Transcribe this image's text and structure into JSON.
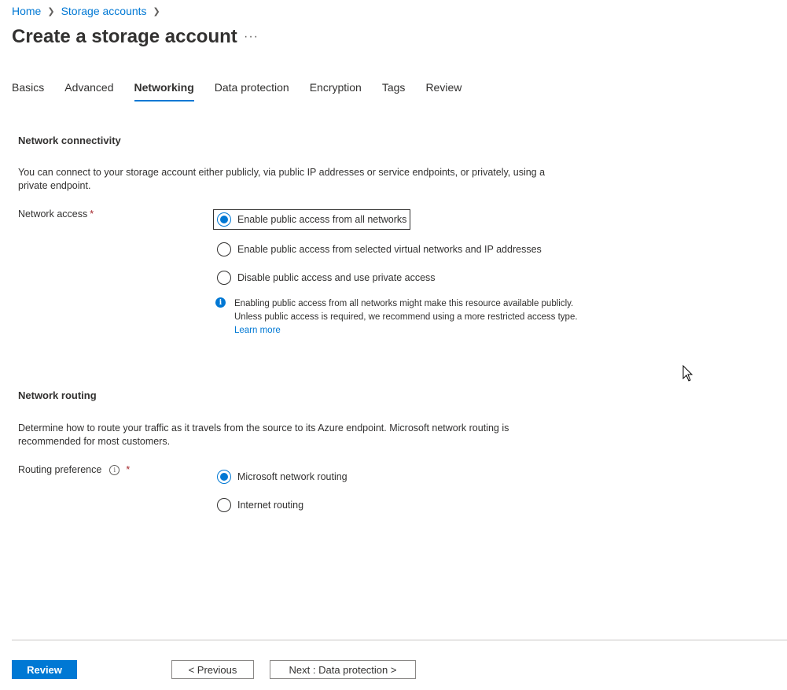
{
  "breadcrumb": {
    "items": [
      "Home",
      "Storage accounts"
    ]
  },
  "page": {
    "title": "Create a storage account",
    "more": "···"
  },
  "tabs": [
    {
      "label": "Basics"
    },
    {
      "label": "Advanced"
    },
    {
      "label": "Networking",
      "active": true
    },
    {
      "label": "Data protection"
    },
    {
      "label": "Encryption"
    },
    {
      "label": "Tags"
    },
    {
      "label": "Review"
    }
  ],
  "connectivity": {
    "title": "Network connectivity",
    "description": "You can connect to your storage account either publicly, via public IP addresses or service endpoints, or privately, using a private endpoint.",
    "label": "Network access",
    "required": "*",
    "options": [
      "Enable public access from all networks",
      "Enable public access from selected virtual networks and IP addresses",
      "Disable public access and use private access"
    ],
    "selected_index": 0,
    "info_text": "Enabling public access from all networks might make this resource available publicly. Unless public access is required, we recommend using a more restricted access type.",
    "learn_more": "Learn more"
  },
  "routing": {
    "title": "Network routing",
    "description": "Determine how to route your traffic as it travels from the source to its Azure endpoint. Microsoft network routing is recommended for most customers.",
    "label": "Routing preference",
    "required": "*",
    "options": [
      "Microsoft network routing",
      "Internet routing"
    ],
    "selected_index": 0
  },
  "footer": {
    "review": "Review",
    "previous": "< Previous",
    "next": "Next : Data protection >"
  },
  "colors": {
    "accent": "#0078d4",
    "required": "#a4262c"
  }
}
